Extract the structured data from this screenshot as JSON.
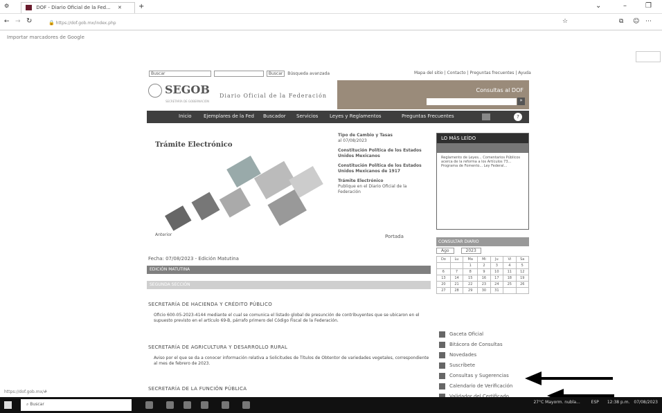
{
  "browser": {
    "tab_title": "DOF - Diario Oficial de la Fed...",
    "url": "https://dof.gob.mx/index.php",
    "bookmark": "Importar marcadores de Google"
  },
  "page": {
    "top_search": {
      "label": "Buscar",
      "input_value": "",
      "button": "Buscar",
      "advanced": "Búsqueda avanzada"
    },
    "top_links": "Mapa del sitio | Contacto | Preguntas frecuentes | Ayuda",
    "logo": "SEGOB",
    "logo_sub": "SECRETARÍA DE GOBERNACIÓN",
    "dof_name": "Diario Oficial de la Federación",
    "header_right": "Consultas al DOF",
    "nav": [
      "Inicio",
      "Ejemplares de la Fed",
      "Buscador",
      "Servicios",
      "Leyes y Reglamentos",
      "Preguntas Frecuentes"
    ],
    "banner_title": "Trámite Electrónico",
    "right_links": [
      {
        "title": "Tipo de Cambio y Tasas",
        "sub": "al 07/08/2023"
      },
      {
        "title": "Constitución Política de los Estados Unidos Mexicanos",
        "sub": ""
      },
      {
        "title": "Constitución Política de los Estados Unidos Mexicanos de 1917",
        "sub": ""
      },
      {
        "title": "Trámite Electrónico",
        "sub": "Publique en el Diario Oficial de la Federación"
      }
    ],
    "banner_prev": "Anterior",
    "banner_next": "Portada",
    "sidebar_title": "LO MÁS LEÍDO",
    "sidebar_text": "Reglamento de Leyes... Comentarios Públicos acerca de la reforma a los Artículos 73... Programa de Fomento... Ley Federal...",
    "calendar": {
      "title": "CONSULTAR DIARIO",
      "month": "Ago",
      "year": "2023",
      "days_header": [
        "Do",
        "Lu",
        "Ma",
        "Mi",
        "Ju",
        "Vi",
        "Sa"
      ],
      "rows": [
        [
          "",
          "",
          "1",
          "2",
          "3",
          "4",
          "5"
        ],
        [
          "6",
          "7",
          "8",
          "9",
          "10",
          "11",
          "12"
        ],
        [
          "13",
          "14",
          "15",
          "16",
          "17",
          "18",
          "19"
        ],
        [
          "20",
          "21",
          "22",
          "23",
          "24",
          "25",
          "26"
        ],
        [
          "27",
          "28",
          "29",
          "30",
          "31",
          "",
          ""
        ]
      ]
    },
    "date_line": "Fecha: 07/08/2023 - Edición Matutina",
    "edition_bar": "EDICIÓN MATUTINA",
    "second_bar": "SEGUNDA SECCIÓN",
    "sections": [
      {
        "header": "SECRETARÍA DE HACIENDA Y CRÉDITO PÚBLICO",
        "text": "Oficio 600-05-2023-4144 mediante el cual se comunica el listado global de presunción de contribuyentes que se ubicaron en el supuesto previsto en el artículo 69-B, párrafo primero del Código Fiscal de la Federación."
      },
      {
        "header": "SECRETARÍA DE AGRICULTURA Y DESARROLLO RURAL",
        "text": "Aviso por el que se da a conocer información relativa a Solicitudes de Títulos de Obtentor de variedades vegetales, correspondiente al mes de febrero de 2023."
      },
      {
        "header": "SECRETARÍA DE LA FUNCIÓN PÚBLICA",
        "text": ""
      }
    ],
    "side_links": [
      "Gaceta Oficial",
      "Bitácora de Consultas",
      "Novedades",
      "Suscríbete",
      "Consultas y Sugerencias",
      "Calendario de Verificación",
      "Validador del Certificado"
    ]
  },
  "taskbar": {
    "search_placeholder": "Buscar",
    "tray_temp": "27°C Mayorm. nubla...",
    "tray_lang": "ESP",
    "tray_time": "12:38 p.m.",
    "tray_date": "07/08/2023"
  },
  "status_left": "https://dof.gob.mx/#"
}
